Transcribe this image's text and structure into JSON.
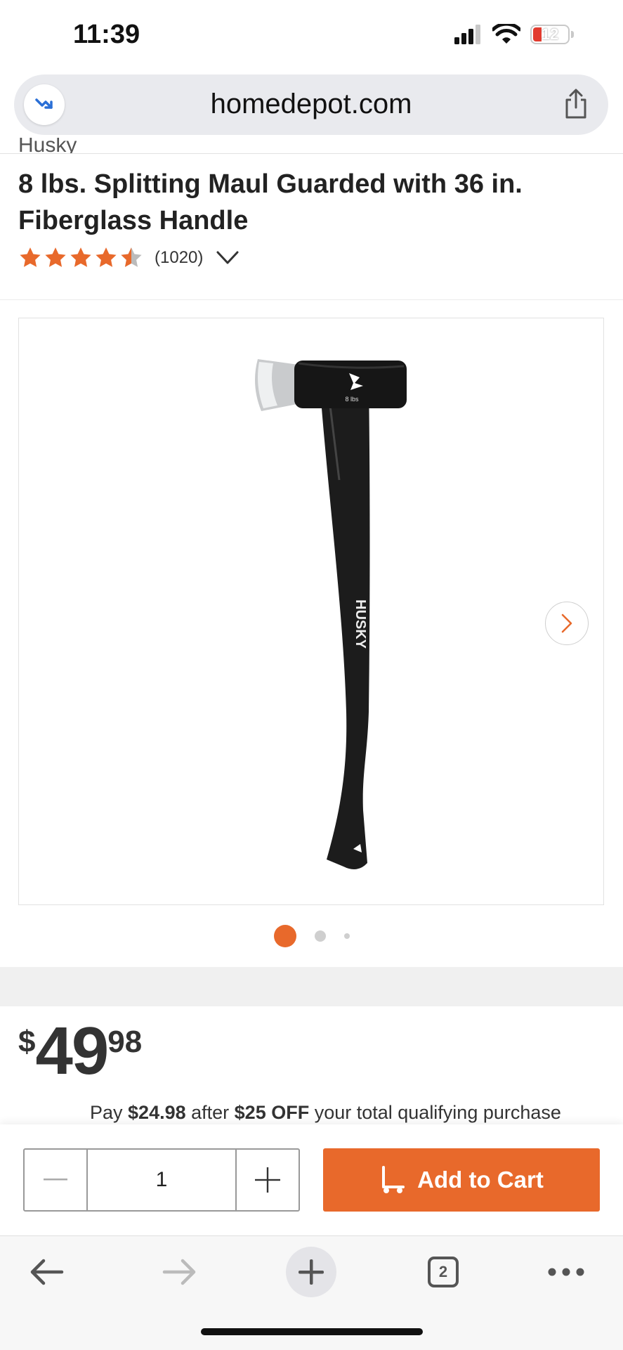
{
  "status_bar": {
    "time": "11:39",
    "battery": "12"
  },
  "browser": {
    "url": "homedepot.com",
    "open_tabs": "2"
  },
  "product": {
    "brand": "Husky",
    "title": "8 lbs. Splitting Maul Guarded with 36 in. Fiberglass Handle",
    "rating": 4.5,
    "review_count": "(1020)",
    "image": {
      "handle_brand": "HUSKY",
      "head_label": "8 lbs"
    },
    "gallery_dots": 3,
    "active_dot": 0
  },
  "price": {
    "currency": "$",
    "dollars": "49",
    "cents": "98",
    "promo": {
      "prefix": "Pay ",
      "amount": "$24.98",
      "middle": " after ",
      "discount": "$25 OFF",
      "suffix": " your total qualifying purchase"
    }
  },
  "cart": {
    "quantity": "1",
    "add_label": "Add to Cart"
  },
  "colors": {
    "accent": "#E8692B",
    "star": "#E8692B",
    "star_empty": "#BBBBBB"
  },
  "icons": [
    "signal-icon",
    "wifi-icon",
    "battery-icon",
    "trending-icon",
    "share-icon",
    "star-icon",
    "chevron-down-icon",
    "chevron-right-icon",
    "minus-icon",
    "plus-icon",
    "cart-dolly-icon",
    "back-arrow-icon",
    "forward-arrow-icon",
    "new-tab-icon",
    "tabs-icon",
    "more-icon"
  ]
}
